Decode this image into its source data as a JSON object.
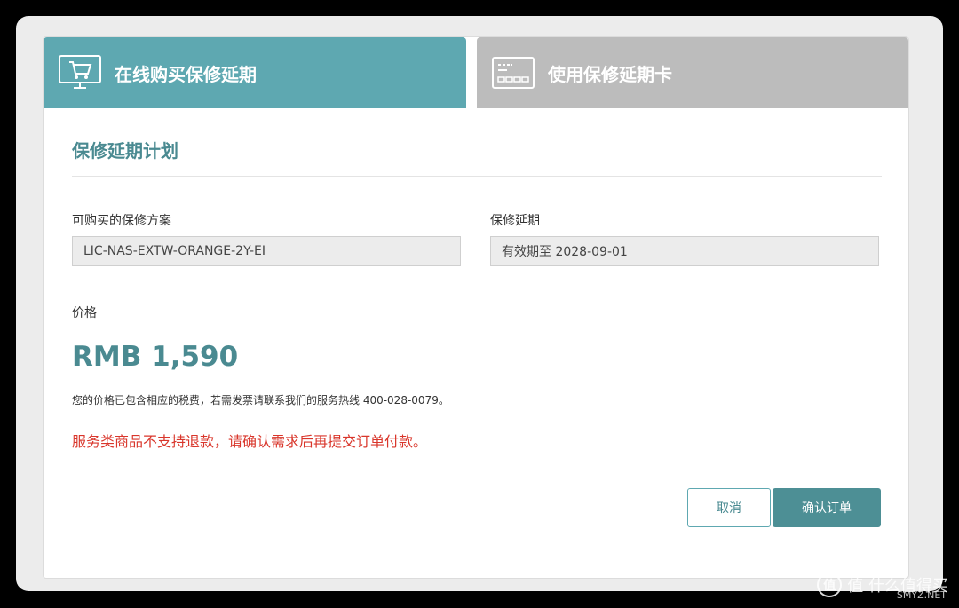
{
  "tabs": {
    "online": {
      "label": "在线购买保修延期",
      "icon": "cart-monitor-icon"
    },
    "card": {
      "label": "使用保修延期卡",
      "icon": "card-icon"
    }
  },
  "section": {
    "title": "保修延期计划"
  },
  "form": {
    "plan_label": "可购买的保修方案",
    "plan_value": "LIC-NAS-EXTW-ORANGE-2Y-EI",
    "extension_label": "保修延期",
    "extension_value": "有效期至 2028-09-01",
    "price_label": "价格",
    "price_value": "RMB 1,590",
    "tax_note": "您的价格已包含相应的税费，若需发票请联系我们的服务热线 400-028-0079。",
    "warning": "服务类商品不支持退款，请确认需求后再提交订单付款。"
  },
  "buttons": {
    "cancel": "取消",
    "confirm": "确认订单"
  },
  "watermark": {
    "text": "值 什么值得买",
    "sub": "SMYZ.NET"
  },
  "colors": {
    "accent": "#5ea8b1",
    "accent_dark": "#4d8f95",
    "warning": "#d9362b",
    "inactive_tab": "#bcbcbc"
  }
}
